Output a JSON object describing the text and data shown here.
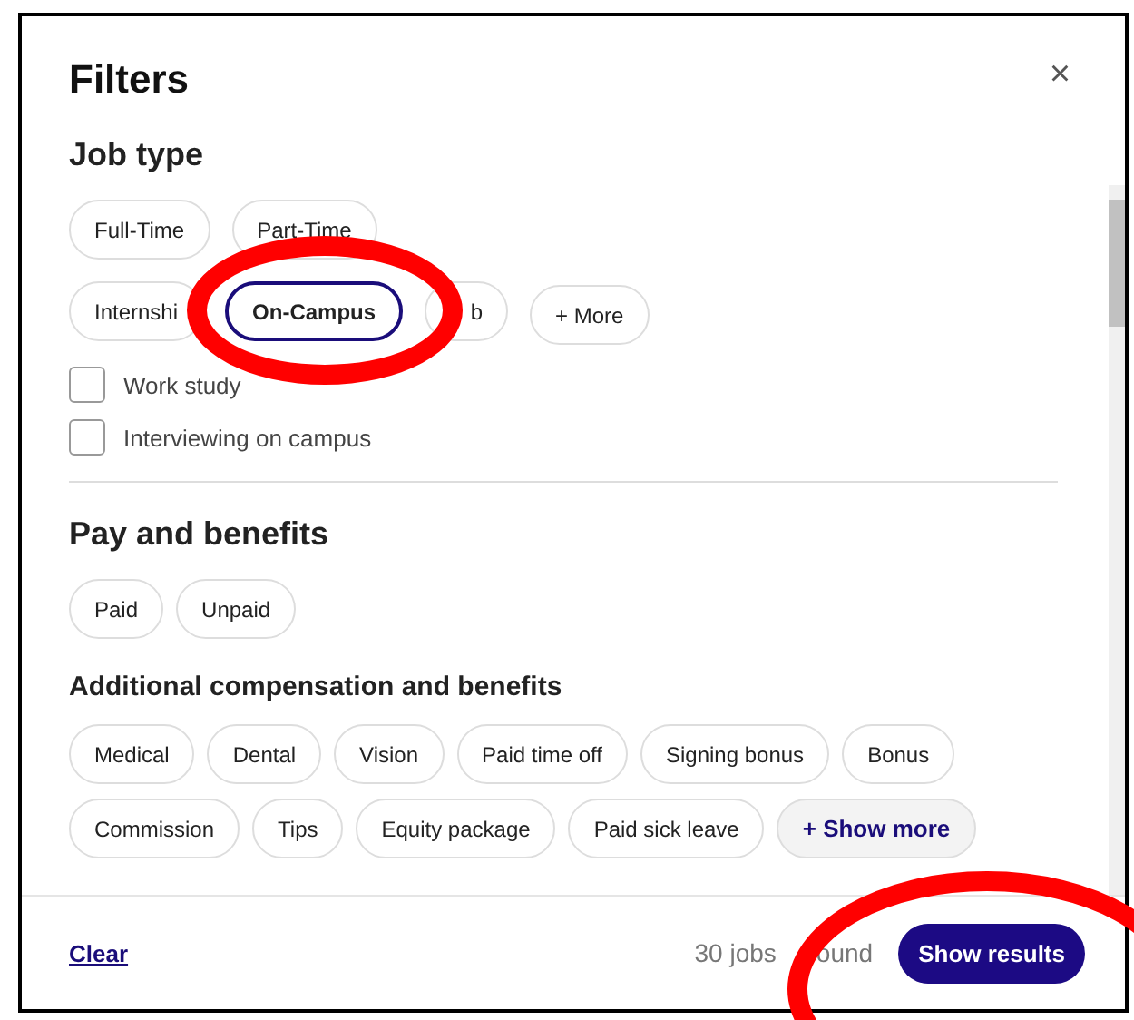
{
  "dialog": {
    "title": "Filters",
    "close": "×"
  },
  "job_type": {
    "title": "Job type",
    "chip_rows": [
      [
        {
          "label": "Full-Time",
          "kind": "chip",
          "selected": false
        },
        {
          "label": "Part-Time",
          "kind": "chip",
          "selected": false
        }
      ],
      [
        {
          "label": "Internshi",
          "kind": "chip",
          "selected": false
        },
        {
          "label": "On-Campus",
          "kind": "chip",
          "selected": true
        },
        {
          "label": "b",
          "kind": "chip",
          "selected": false
        },
        {
          "label": "+ More",
          "kind": "more",
          "selected": false
        }
      ]
    ],
    "checkboxes": [
      {
        "label": "Work study",
        "checked": false
      },
      {
        "label": "Interviewing on campus",
        "checked": false
      }
    ]
  },
  "pay": {
    "title": "Pay and benefits",
    "chips": [
      {
        "label": "Paid",
        "kind": "chip",
        "selected": false
      },
      {
        "label": "Unpaid",
        "kind": "chip",
        "selected": false
      }
    ]
  },
  "compensation": {
    "title": "Additional compensation and benefits",
    "chips": [
      {
        "label": "Medical",
        "kind": "chip",
        "selected": false
      },
      {
        "label": "Dental",
        "kind": "chip",
        "selected": false
      },
      {
        "label": "Vision",
        "kind": "chip",
        "selected": false
      },
      {
        "label": "Paid time off",
        "kind": "chip",
        "selected": false
      },
      {
        "label": "Signing bonus",
        "kind": "chip",
        "selected": false
      },
      {
        "label": "Bonus",
        "kind": "chip",
        "selected": false
      },
      {
        "label": "Commission",
        "kind": "chip",
        "selected": false
      },
      {
        "label": "Tips",
        "kind": "chip",
        "selected": false
      },
      {
        "label": "Equity package",
        "kind": "chip",
        "selected": false
      },
      {
        "label": "Paid sick leave",
        "kind": "chip",
        "selected": false
      },
      {
        "label": "+ Show more",
        "kind": "show_more",
        "selected": false
      }
    ]
  },
  "footer": {
    "clear": "Clear",
    "count": [
      "30 jobs",
      "ound"
    ],
    "submit": "Show results"
  },
  "annotations": [
    {
      "kind": "ellipse"
    },
    {
      "kind": "ellipse"
    }
  ]
}
